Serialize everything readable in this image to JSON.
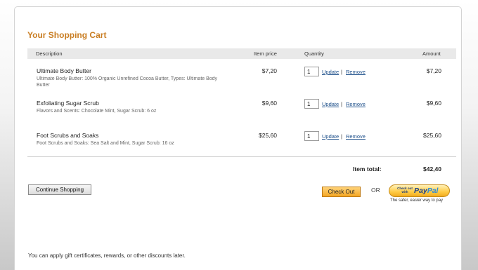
{
  "cart": {
    "title": "Your Shopping Cart",
    "headers": {
      "description": "Description",
      "item_price": "Item price",
      "quantity": "Quantity",
      "amount": "Amount"
    },
    "items": [
      {
        "name": "Ultimate Body Butter",
        "description": "Ultimate Body Butter: 100% Organic Unrefined Cocoa Butter, Types: Ultimate Body Butter",
        "price": "$7,20",
        "quantity": "1",
        "amount": "$7,20"
      },
      {
        "name": "Exfoliating Sugar Scrub",
        "description": "Flavors and Scents: Chocolate Mint, Sugar Scrub: 6 oz",
        "price": "$9,60",
        "quantity": "1",
        "amount": "$9,60"
      },
      {
        "name": "Foot Scrubs and Soaks",
        "description": "Foot Scrubs and Soaks: Sea Salt and Mint, Sugar Scrub: 16 oz",
        "price": "$25,60",
        "quantity": "1",
        "amount": "$25,60"
      }
    ],
    "update_label": "Update",
    "separator": "|",
    "remove_label": "Remove",
    "total_label": "Item total:",
    "total_value": "$42,40"
  },
  "actions": {
    "continue_label": "Continue Shopping",
    "checkout_label": "Check Out",
    "or_label": "OR",
    "paypal_small": "Check out with",
    "paypal_logo_1": "Pay",
    "paypal_logo_2": "Pal",
    "paypal_tagline": "The safer, easier way to pay"
  },
  "footer_note": "You can apply gift certificates, rewards, or other discounts later."
}
